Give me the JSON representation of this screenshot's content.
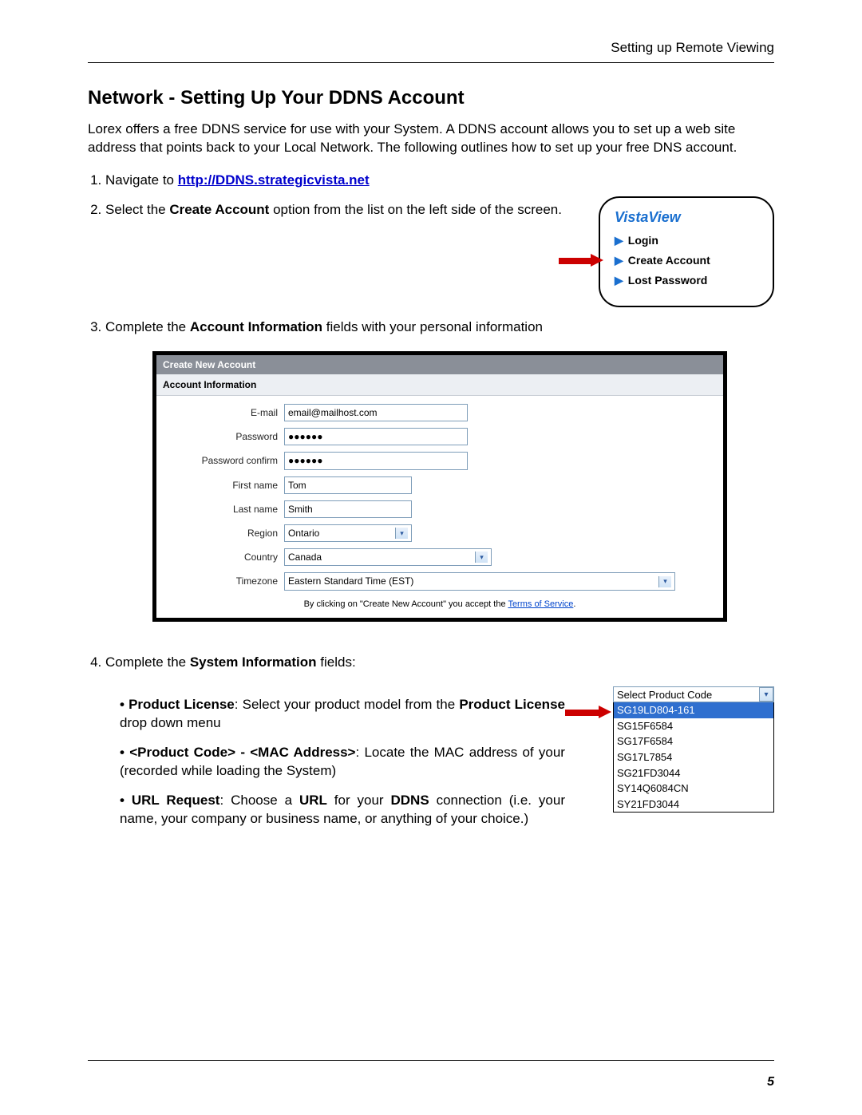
{
  "header": {
    "breadcrumb": "Setting up Remote Viewing"
  },
  "title": "Network - Setting Up Your DDNS Account",
  "intro": "Lorex offers a free DDNS service for use with your System. A DDNS account allows you to set up a web site address that points back to your Local Network. The following outlines how to set up your free DNS account.",
  "steps": {
    "s1_prefix": "Navigate to ",
    "s1_link": "http://DDNS.strategicvista.net",
    "s2_a": "Select the ",
    "s2_b": "Create Account",
    "s2_c": " option from the list on the left side of the screen.",
    "s3_a": "Complete the ",
    "s3_b": "Account Information",
    "s3_c": " fields with your personal information",
    "s4_a": "Complete the ",
    "s4_b": "System Information",
    "s4_c": " fields:"
  },
  "vista": {
    "title": "VistaView",
    "items": [
      "Login",
      "Create Account",
      "Lost Password"
    ]
  },
  "form": {
    "titlebar": "Create New Account",
    "section": "Account Information",
    "labels": {
      "email": "E-mail",
      "password": "Password",
      "password_confirm": "Password confirm",
      "first_name": "First name",
      "last_name": "Last name",
      "region": "Region",
      "country": "Country",
      "timezone": "Timezone"
    },
    "values": {
      "email": "email@mailhost.com",
      "password": "●●●●●●",
      "password_confirm": "●●●●●●",
      "first_name": "Tom",
      "last_name": "Smith",
      "region": "Ontario",
      "country": "Canada",
      "timezone": "Eastern Standard Time (EST)"
    },
    "tos_prefix": "By clicking on \"Create New Account\" you accept the ",
    "tos_link": "Terms of Service",
    "tos_suffix": "."
  },
  "bullets": {
    "b1_a": "Product License",
    "b1_b": ": Select your product model from the ",
    "b1_c": "Product License",
    "b1_d": " drop down menu",
    "b2_a": "<Product Code> - <MAC Address>",
    "b2_b": ": Locate the MAC address of your (recorded while loading the System)",
    "b3_a": "URL Request",
    "b3_b": ": Choose a ",
    "b3_c": "URL",
    "b3_d": " for your ",
    "b3_e": "DDNS",
    "b3_f": " connection (i.e. your name, your company or business name, or anything of your choice.)"
  },
  "product_select": {
    "placeholder": "Select Product Code",
    "options": [
      "SG19LD804-161",
      "SG15F6584",
      "SG17F6584",
      "SG17L7854",
      "SG21FD3044",
      "SY14Q6084CN",
      "SY21FD3044"
    ]
  },
  "page_number": "5"
}
